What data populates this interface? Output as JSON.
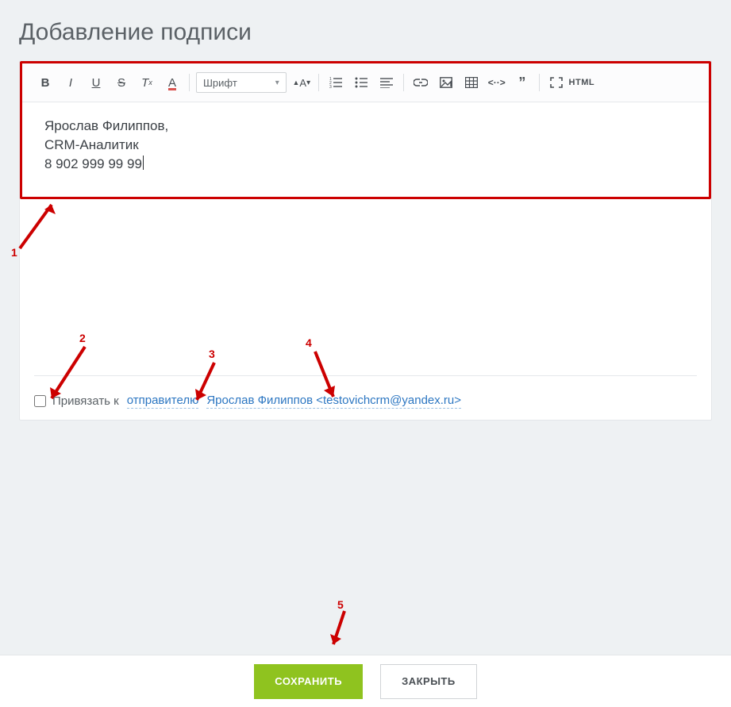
{
  "title": "Добавление подписи",
  "toolbar": {
    "font_label": "Шрифт"
  },
  "signature": {
    "line1": "Ярослав Филиппов,",
    "line2": "CRM-Аналитик",
    "line3": "8 902 999 99 99"
  },
  "bind": {
    "label": "Привязать к",
    "role": "отправителю",
    "sender": "Ярослав Филиппов <testovichcrm@yandex.ru>"
  },
  "buttons": {
    "save": "СОХРАНИТЬ",
    "close": "ЗАКРЫТЬ"
  },
  "annotations": {
    "n1": "1",
    "n2": "2",
    "n3": "3",
    "n4": "4",
    "n5": "5"
  }
}
